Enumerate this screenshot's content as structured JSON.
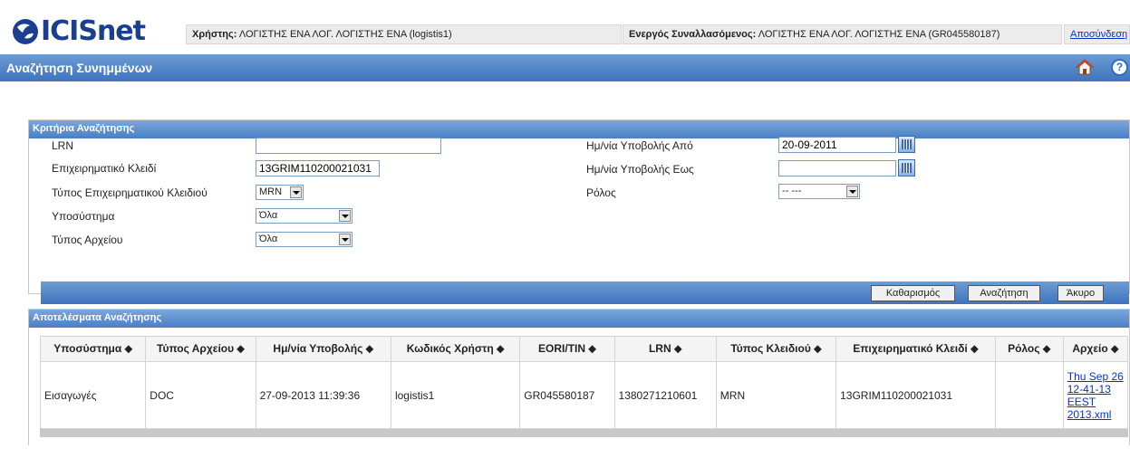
{
  "header": {
    "logo_text": "ICISnet",
    "user_label": "Χρήστης:",
    "user_value": " ΛΟΓΙΣΤΗΣ ΕΝΑ ΛΟΓ. ΛΟΓΙΣΤΗΣ ΕΝΑ (logistis1)",
    "partner_label": "Ενεργός Συναλλασόμενος:",
    "partner_value": " ΛΟΓΙΣΤΗΣ ΕΝΑ ΛΟΓ. ΛΟΓΙΣΤΗΣ ΕΝΑ (GR045580187)",
    "logout_label": "Αποσύνδεση",
    "page_title": "Αναζήτηση Συνημμένων",
    "help_glyph": "?"
  },
  "criteria": {
    "title": "Κριτήρια Αναζήτησης",
    "lrn_label": "LRN",
    "lrn_value": "",
    "business_key_label": "Επιχειρηματικό Κλειδί",
    "business_key_value": "13GRIM110200021031",
    "key_type_label": "Τύπος Επιχειρηματικού Κλειδιού",
    "key_type_value": "MRN",
    "subsystem_label": "Υποσύστημα",
    "subsystem_value": "Όλα",
    "file_type_label": "Τύπος Αρχείου",
    "file_type_value": "Όλα",
    "date_from_label": "Ημ/νία Υποβολής Από",
    "date_from_value": "20-09-2011",
    "date_to_label": "Ημ/νία Υποβολής Εως",
    "date_to_value": "",
    "role_label": "Ρόλος",
    "role_value": "-- ---",
    "clear_button": "Καθαρισμός",
    "search_button": "Αναζήτηση",
    "cancel_button": "Άκυρο"
  },
  "results": {
    "title": "Αποτελέσματα Αναζήτησης",
    "columns": [
      "Υποσύστημα ⬥",
      "Τύπος Αρχείου ⬥",
      "Ημ/νία Υποβολής ⬥",
      "Κωδικός Χρήστη ⬥",
      "EORI/TIN ⬥",
      "LRN ⬥",
      "Τύπος Κλειδιού ⬥",
      "Επιχειρηματικό Κλειδί ⬥",
      "Ρόλος ⬥",
      "Αρχείο ⬥"
    ],
    "rows": [
      {
        "subsystem": "Εισαγωγές",
        "file_type": "DOC",
        "date": "27-09-2013 11:39:36",
        "user_code": "logistis1",
        "eori": "GR045580187",
        "lrn": "1380271210601",
        "key_type": "MRN",
        "business_key": "13GRIM110200021031",
        "role": "",
        "file_line1": "Thu Sep 26",
        "file_line2": "12-41-13",
        "file_line3": "EEST",
        "file_line4": "2013.xml"
      }
    ]
  },
  "colors": {
    "brand": "#1b3f8f",
    "bar_top": "#6d9bd4",
    "bar_bottom": "#3f74bd",
    "link": "#0033cc"
  },
  "icons": [
    "globe-logo-icon",
    "home-icon",
    "help-icon",
    "calendar-icon",
    "dropdown-arrow-icon",
    "sort-icon"
  ]
}
